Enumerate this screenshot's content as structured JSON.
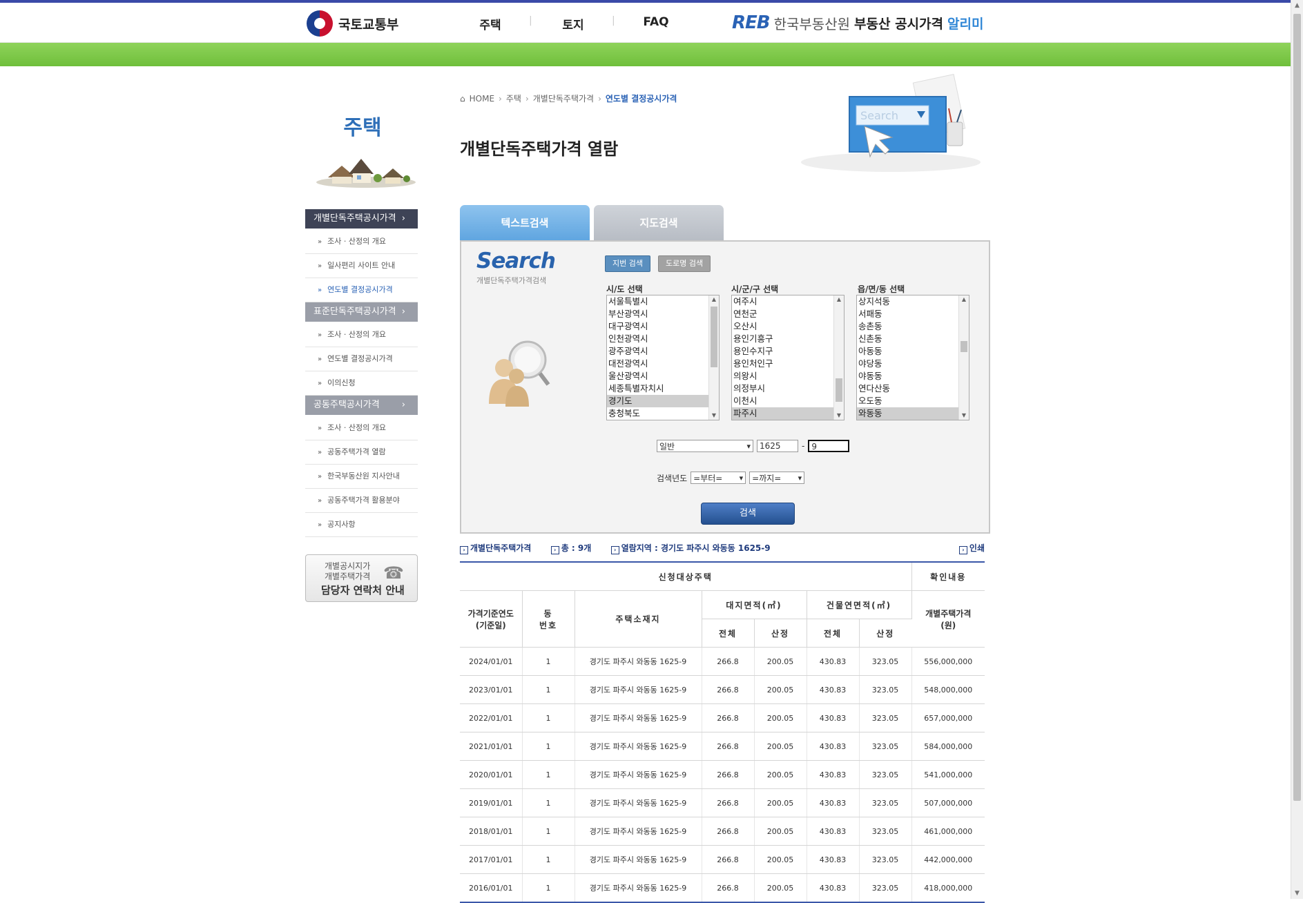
{
  "header": {
    "ministry": "국토교통부",
    "nav": [
      "주택",
      "토지",
      "FAQ"
    ],
    "reb_mark": "REB",
    "reb_org": "한국부동산원",
    "service": "부동산 공시가격",
    "service_highlight": "알리미"
  },
  "sidebar": {
    "title": "주택",
    "categories": [
      {
        "label": "개별단독주택공시가격",
        "items": [
          "조사 · 산정의 개요",
          "일사편리 사이트 안내",
          "연도별 결정공시가격"
        ]
      },
      {
        "label": "표준단독주택공시가격",
        "items": [
          "조사 · 산정의 개요",
          "연도별 결정공시가격",
          "이의신청"
        ]
      },
      {
        "label": "공동주택공시가격",
        "items": [
          "조사 · 산정의 개요",
          "공동주택가격 열람",
          "한국부동산원 지사안내",
          "공동주택가격 활용분야",
          "공지사항"
        ]
      }
    ],
    "contact_line1": "개별공시지가",
    "contact_line2": "개별주택가격",
    "contact_line3": "담당자 연락처 안내"
  },
  "breadcrumb": {
    "home": "HOME",
    "l1": "주택",
    "l2": "개별단독주택가격",
    "current": "연도별 결정공시가격"
  },
  "page_title": "개별단독주택가격 열람",
  "deco_search_text": "Search",
  "tabs": {
    "text_search": "텍스트검색",
    "map_search": "지도검색"
  },
  "search_panel": {
    "logo": "Search",
    "subtitle": "개별단독주택가격검색",
    "btn_jibun": "지번 검색",
    "btn_road": "도로명 검색",
    "label_sido": "시/도 선택",
    "label_sigungu": "시/군/구 선택",
    "label_dong": "읍/면/동 선택",
    "sido_options": [
      "서울특별시",
      "부산광역시",
      "대구광역시",
      "인천광역시",
      "광주광역시",
      "대전광역시",
      "울산광역시",
      "세종특별자치시",
      "경기도",
      "충청북도"
    ],
    "sido_selected": 8,
    "sigungu_options": [
      "여주시",
      "연천군",
      "오산시",
      "용인기흥구",
      "용인수지구",
      "용인처인구",
      "의왕시",
      "의정부시",
      "이천시",
      "파주시"
    ],
    "sigungu_selected": 9,
    "dong_options": [
      "상지석동",
      "서패동",
      "송촌동",
      "신촌동",
      "아동동",
      "야당동",
      "야동동",
      "연다산동",
      "오도동",
      "와동동"
    ],
    "dong_selected": 9,
    "land_type": "일반",
    "bunji_main": "1625",
    "bunji_dash": "-",
    "bunji_sub": "9",
    "year_label": "검색년도",
    "year_from": "=부터=",
    "year_to": "=까지=",
    "search_button": "검색"
  },
  "result_info": {
    "label": "개별단독주택가격",
    "total": "총 : 9개",
    "region": "열람지역 : 경기도 파주시 와동동 1625-9",
    "print": "인쇄"
  },
  "table": {
    "group_target": "신청대상주택",
    "group_confirm": "확인내용",
    "col_date": "가격기준연도\n(기준일)",
    "col_dong": "동\n번호",
    "col_addr": "주택소재지",
    "col_land": "대지면적(㎡)",
    "col_bldg": "건물연면적(㎡)",
    "col_total": "전체",
    "col_calc": "산정",
    "col_price": "개별주택가격\n(원)",
    "rows": [
      [
        "2024/01/01",
        "1",
        "경기도 파주시 와동동 1625-9",
        "266.8",
        "200.05",
        "430.83",
        "323.05",
        "556,000,000"
      ],
      [
        "2023/01/01",
        "1",
        "경기도 파주시 와동동 1625-9",
        "266.8",
        "200.05",
        "430.83",
        "323.05",
        "548,000,000"
      ],
      [
        "2022/01/01",
        "1",
        "경기도 파주시 와동동 1625-9",
        "266.8",
        "200.05",
        "430.83",
        "323.05",
        "657,000,000"
      ],
      [
        "2021/01/01",
        "1",
        "경기도 파주시 와동동 1625-9",
        "266.8",
        "200.05",
        "430.83",
        "323.05",
        "584,000,000"
      ],
      [
        "2020/01/01",
        "1",
        "경기도 파주시 와동동 1625-9",
        "266.8",
        "200.05",
        "430.83",
        "323.05",
        "541,000,000"
      ],
      [
        "2019/01/01",
        "1",
        "경기도 파주시 와동동 1625-9",
        "266.8",
        "200.05",
        "430.83",
        "323.05",
        "507,000,000"
      ],
      [
        "2018/01/01",
        "1",
        "경기도 파주시 와동동 1625-9",
        "266.8",
        "200.05",
        "430.83",
        "323.05",
        "461,000,000"
      ],
      [
        "2017/01/01",
        "1",
        "경기도 파주시 와동동 1625-9",
        "266.8",
        "200.05",
        "430.83",
        "323.05",
        "442,000,000"
      ],
      [
        "2016/01/01",
        "1",
        "경기도 파주시 와동동 1625-9",
        "266.8",
        "200.05",
        "430.83",
        "323.05",
        "418,000,000"
      ]
    ]
  },
  "colors": {
    "brand_blue": "#2a62b5",
    "green_bar": "#7dc84a",
    "nav_dark": "#3e4356"
  }
}
